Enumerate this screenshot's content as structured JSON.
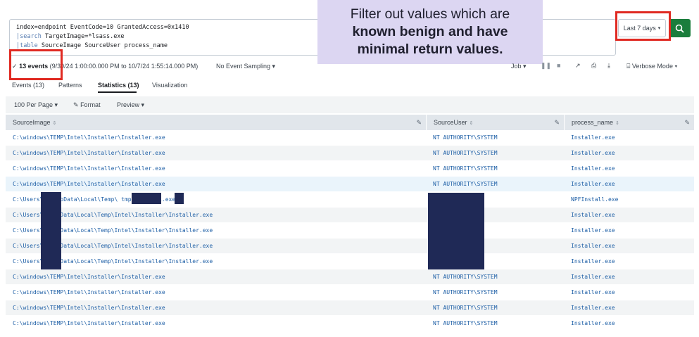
{
  "search": {
    "line1": "index=endpoint EventCode=10 GrantedAccess=0x1410",
    "line2_pipe": "|",
    "line2_cmd": "search",
    "line2_rest": " TargetImage=*lsass.exe",
    "line3_pipe": "|",
    "line3_cmd": "table",
    "line3_rest": " SourceImage SourceUser process_name"
  },
  "time_picker": {
    "label": "Last 7 days"
  },
  "callout": {
    "line1": "Filter out values which are",
    "line2": "known benign and have",
    "line3": "minimal return values."
  },
  "status": {
    "check": "✓",
    "events": "13 events",
    "range": " (9/30/24 1:00:00.000 PM to 10/7/24 1:55:14.000 PM)",
    "sampling": "No Event Sampling ▾",
    "job": "Job ▾",
    "verbose": "Verbose Mode ▾"
  },
  "tabs": [
    "Events (13)",
    "Patterns",
    "Statistics (13)",
    "Visualization"
  ],
  "toolbar": {
    "per_page": "100 Per Page ▾",
    "format": "Format",
    "preview": "Preview ▾"
  },
  "table": {
    "columns": [
      "SourceImage",
      "SourceUser",
      "process_name"
    ],
    "rows": [
      [
        "C:\\windows\\TEMP\\Intel\\Installer\\Installer.exe",
        "NT AUTHORITY\\SYSTEM",
        "Installer.exe"
      ],
      [
        "C:\\windows\\TEMP\\Intel\\Installer\\Installer.exe",
        "NT AUTHORITY\\SYSTEM",
        "Installer.exe"
      ],
      [
        "C:\\windows\\TEMP\\Intel\\Installer\\Installer.exe",
        "NT AUTHORITY\\SYSTEM",
        "Installer.exe"
      ],
      [
        "C:\\windows\\TEMP\\Intel\\Installer\\Installer.exe",
        "NT AUTHORITY\\SYSTEM",
        "Installer.exe"
      ],
      [
        "C:\\Users\\      n\\AppData\\Local\\Temp\\           tmp\\   Install.exe",
        "",
        "NPFInstall.exe"
      ],
      [
        "C:\\Users\\      \\AppData\\Local\\Temp\\Intel\\Installer\\Installer.exe",
        "",
        "Installer.exe"
      ],
      [
        "C:\\Users\\      \\AppData\\Local\\Temp\\Intel\\Installer\\Installer.exe",
        "",
        "Installer.exe"
      ],
      [
        "C:\\Users\\      \\AppData\\Local\\Temp\\Intel\\Installer\\Installer.exe",
        "",
        "Installer.exe"
      ],
      [
        "C:\\Users\\      \\AppData\\Local\\Temp\\Intel\\Installer\\Installer.exe",
        "",
        "Installer.exe"
      ],
      [
        "C:\\windows\\TEMP\\Intel\\Installer\\Installer.exe",
        "NT AUTHORITY\\SYSTEM",
        "Installer.exe"
      ],
      [
        "C:\\windows\\TEMP\\Intel\\Installer\\Installer.exe",
        "NT AUTHORITY\\SYSTEM",
        "Installer.exe"
      ],
      [
        "C:\\windows\\TEMP\\Intel\\Installer\\Installer.exe",
        "NT AUTHORITY\\SYSTEM",
        "Installer.exe"
      ],
      [
        "C:\\windows\\TEMP\\Intel\\Installer\\Installer.exe",
        "NT AUTHORITY\\SYSTEM",
        "Installer.exe"
      ]
    ]
  },
  "colors": {
    "accent_green": "#1a7d3c",
    "highlight_red": "#e02a22",
    "link_blue": "#1e5fa6",
    "callout_bg": "#dcd6f2",
    "redaction": "#1f2956"
  }
}
